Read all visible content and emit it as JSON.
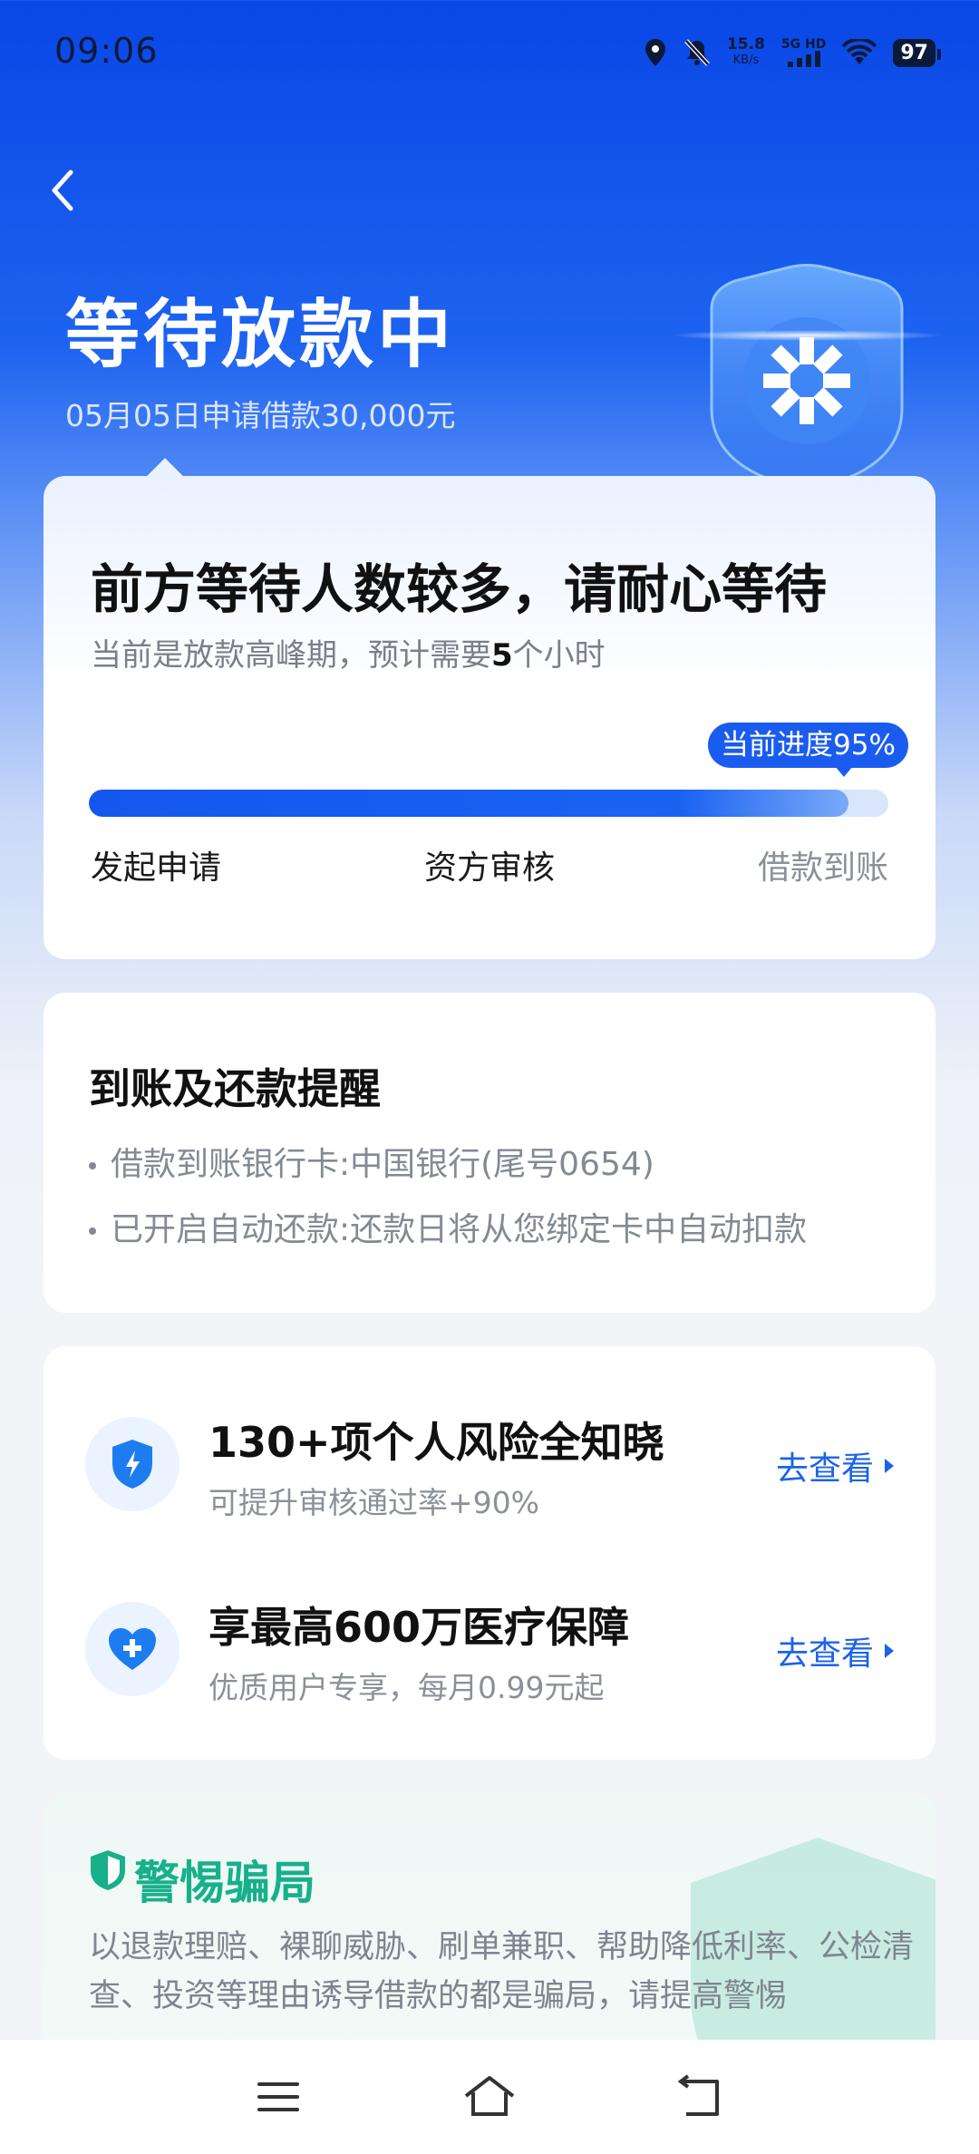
{
  "status_bar": {
    "time": "09:06",
    "net_speed_value": "15.8",
    "net_speed_unit": "KB/s",
    "net_type": "5G HD",
    "battery": "97"
  },
  "header": {
    "title": "等待放款中",
    "subtitle": "05月05日申请借款30,000元"
  },
  "progress_card": {
    "headline": "前方等待人数较多，请耐心等待",
    "desc_prefix": "当前是放款高峰期，预计需要",
    "desc_highlight": "5",
    "desc_suffix": "个小时",
    "badge": "当前进度95%",
    "progress": 0.95,
    "steps": [
      {
        "label": "发起申请"
      },
      {
        "label": "资方审核"
      },
      {
        "label": "借款到账"
      }
    ]
  },
  "reminder_card": {
    "title": "到账及还款提醒",
    "lines": [
      "借款到账银行卡:中国银行(尾号0654)",
      "已开启自动还款:还款日将从您绑定卡中自动扣款"
    ]
  },
  "services_card": {
    "items": [
      {
        "title": "130+项个人风险全知晓",
        "sub": "可提升审核通过率+90%",
        "link": "去查看",
        "icon": "shield-lightning-icon"
      },
      {
        "title": "享最高600万医疗保障",
        "sub": "优质用户专享，每月0.99元起",
        "link": "去查看",
        "icon": "heart-plus-icon"
      }
    ]
  },
  "fraud_card": {
    "title": "警惕骗局",
    "text": "以退款理赔、裸聊威胁、刷单兼职、帮助降低利率、公检清查、投资等理由诱导借款的都是骗局，请提高警惕"
  },
  "colors": {
    "primary_blue": "#1a5cf0",
    "link_blue": "#1c63e8",
    "fraud_green": "#17b08a"
  }
}
